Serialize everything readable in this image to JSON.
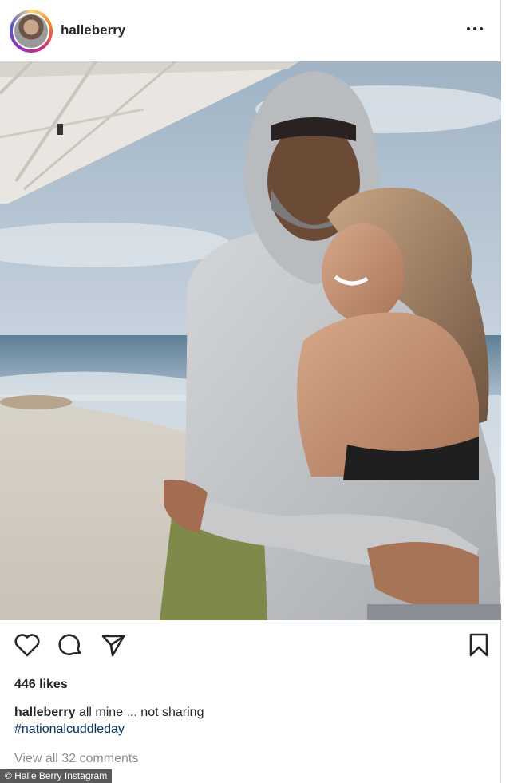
{
  "post": {
    "username": "halleberry",
    "likes": "446 likes",
    "caption_user": "halleberry",
    "caption_text": "all mine ... not sharing",
    "hashtag": "#nationalcuddleday",
    "comments_link": "View all 32 comments"
  },
  "icons": {
    "more": "more-options-icon",
    "like": "heart-icon",
    "comment": "comment-icon",
    "share": "share-icon",
    "save": "bookmark-icon"
  },
  "credit": "© Halle Berry Instagram",
  "colors": {
    "link": "#00376b",
    "muted": "#8e8e8e",
    "text": "#262626"
  }
}
